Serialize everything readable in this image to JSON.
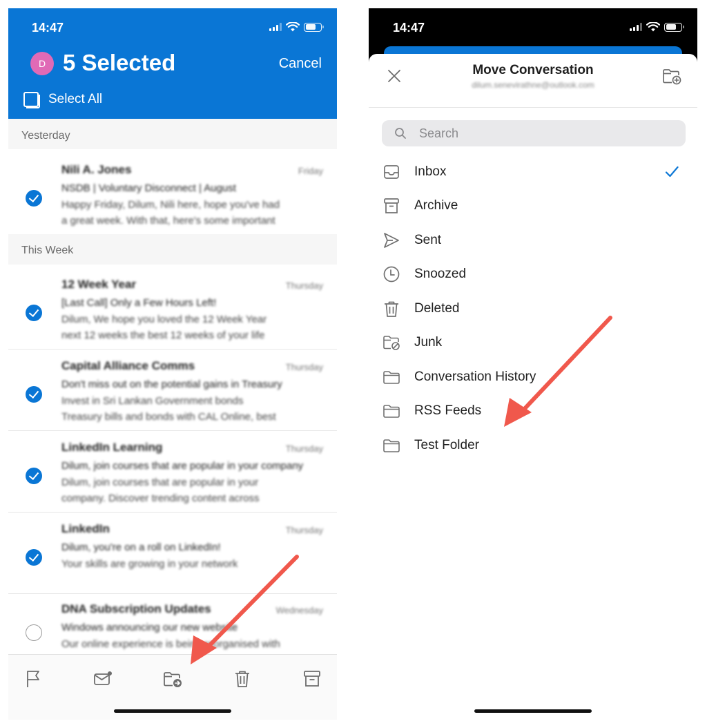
{
  "left": {
    "status_time": "14:47",
    "title": "5 Selected",
    "cancel_label": "Cancel",
    "avatar_initial": "D",
    "select_all_label": "Select All",
    "sections": [
      {
        "label": "Yesterday"
      },
      {
        "label": "This Week"
      }
    ],
    "mails": [
      {
        "sender": "Nili A. Jones",
        "date": "Friday",
        "line1": "NSDB | Voluntary Disconnect | August",
        "line2": "Happy Friday, Dilum, Nili here, hope you've had",
        "line3": "a great week. With that, here's some important",
        "checked": true
      },
      {
        "sender": "12 Week Year",
        "date": "Thursday",
        "line1": "[Last Call] Only a Few Hours Left!",
        "line2": "Dilum, We hope you loved the 12 Week Year",
        "line3": "next 12 weeks the best 12 weeks of your life",
        "checked": true
      },
      {
        "sender": "Capital Alliance Comms",
        "date": "Thursday",
        "line1": "Don't miss out on the potential gains in Treasury",
        "line2": "Invest in Sri Lankan Government bonds",
        "line3": "Treasury bills and bonds with CAL Online, best",
        "checked": true
      },
      {
        "sender": "LinkedIn Learning",
        "date": "Thursday",
        "line1": "Dilum, join courses that are popular in your company",
        "line2": "Dilum, join courses that are popular in your",
        "line3": "company. Discover trending content across",
        "checked": true
      },
      {
        "sender": "LinkedIn",
        "date": "Thursday",
        "line1": "Dilum, you're on a roll on LinkedIn!",
        "line2": "Your skills are growing in your network",
        "line3": "",
        "checked": true
      },
      {
        "sender": "DNA Subscription Updates",
        "date": "Wednesday",
        "line1": "Windows announcing our new website",
        "line2": "Our online experience is being reorganised with",
        "line3": "",
        "checked": false
      }
    ],
    "toolbar": {
      "flag_icon": "flag-icon",
      "mark_read_icon": "mail-unread-icon",
      "move_icon": "folder-move-icon",
      "delete_icon": "trash-icon",
      "archive_icon": "archive-icon"
    }
  },
  "right": {
    "status_time": "14:47",
    "sheet_title": "Move Conversation",
    "sheet_subtitle": "dilum.senevirathne@outlook.com",
    "search_placeholder": "Search",
    "folders": [
      {
        "label": "Inbox",
        "icon": "inbox-icon",
        "selected": true
      },
      {
        "label": "Archive",
        "icon": "archive-icon",
        "selected": false
      },
      {
        "label": "Sent",
        "icon": "send-icon",
        "selected": false
      },
      {
        "label": "Snoozed",
        "icon": "clock-icon",
        "selected": false
      },
      {
        "label": "Deleted",
        "icon": "trash-icon",
        "selected": false
      },
      {
        "label": "Junk",
        "icon": "junk-folder-icon",
        "selected": false
      },
      {
        "label": "Conversation History",
        "icon": "folder-icon",
        "selected": false
      },
      {
        "label": "RSS Feeds",
        "icon": "folder-icon",
        "selected": false
      },
      {
        "label": "Test Folder",
        "icon": "folder-icon",
        "selected": false
      }
    ]
  },
  "colors": {
    "accent": "#0a76d5",
    "avatar": "#e06ab6",
    "annotation_arrow": "#f0584c"
  }
}
